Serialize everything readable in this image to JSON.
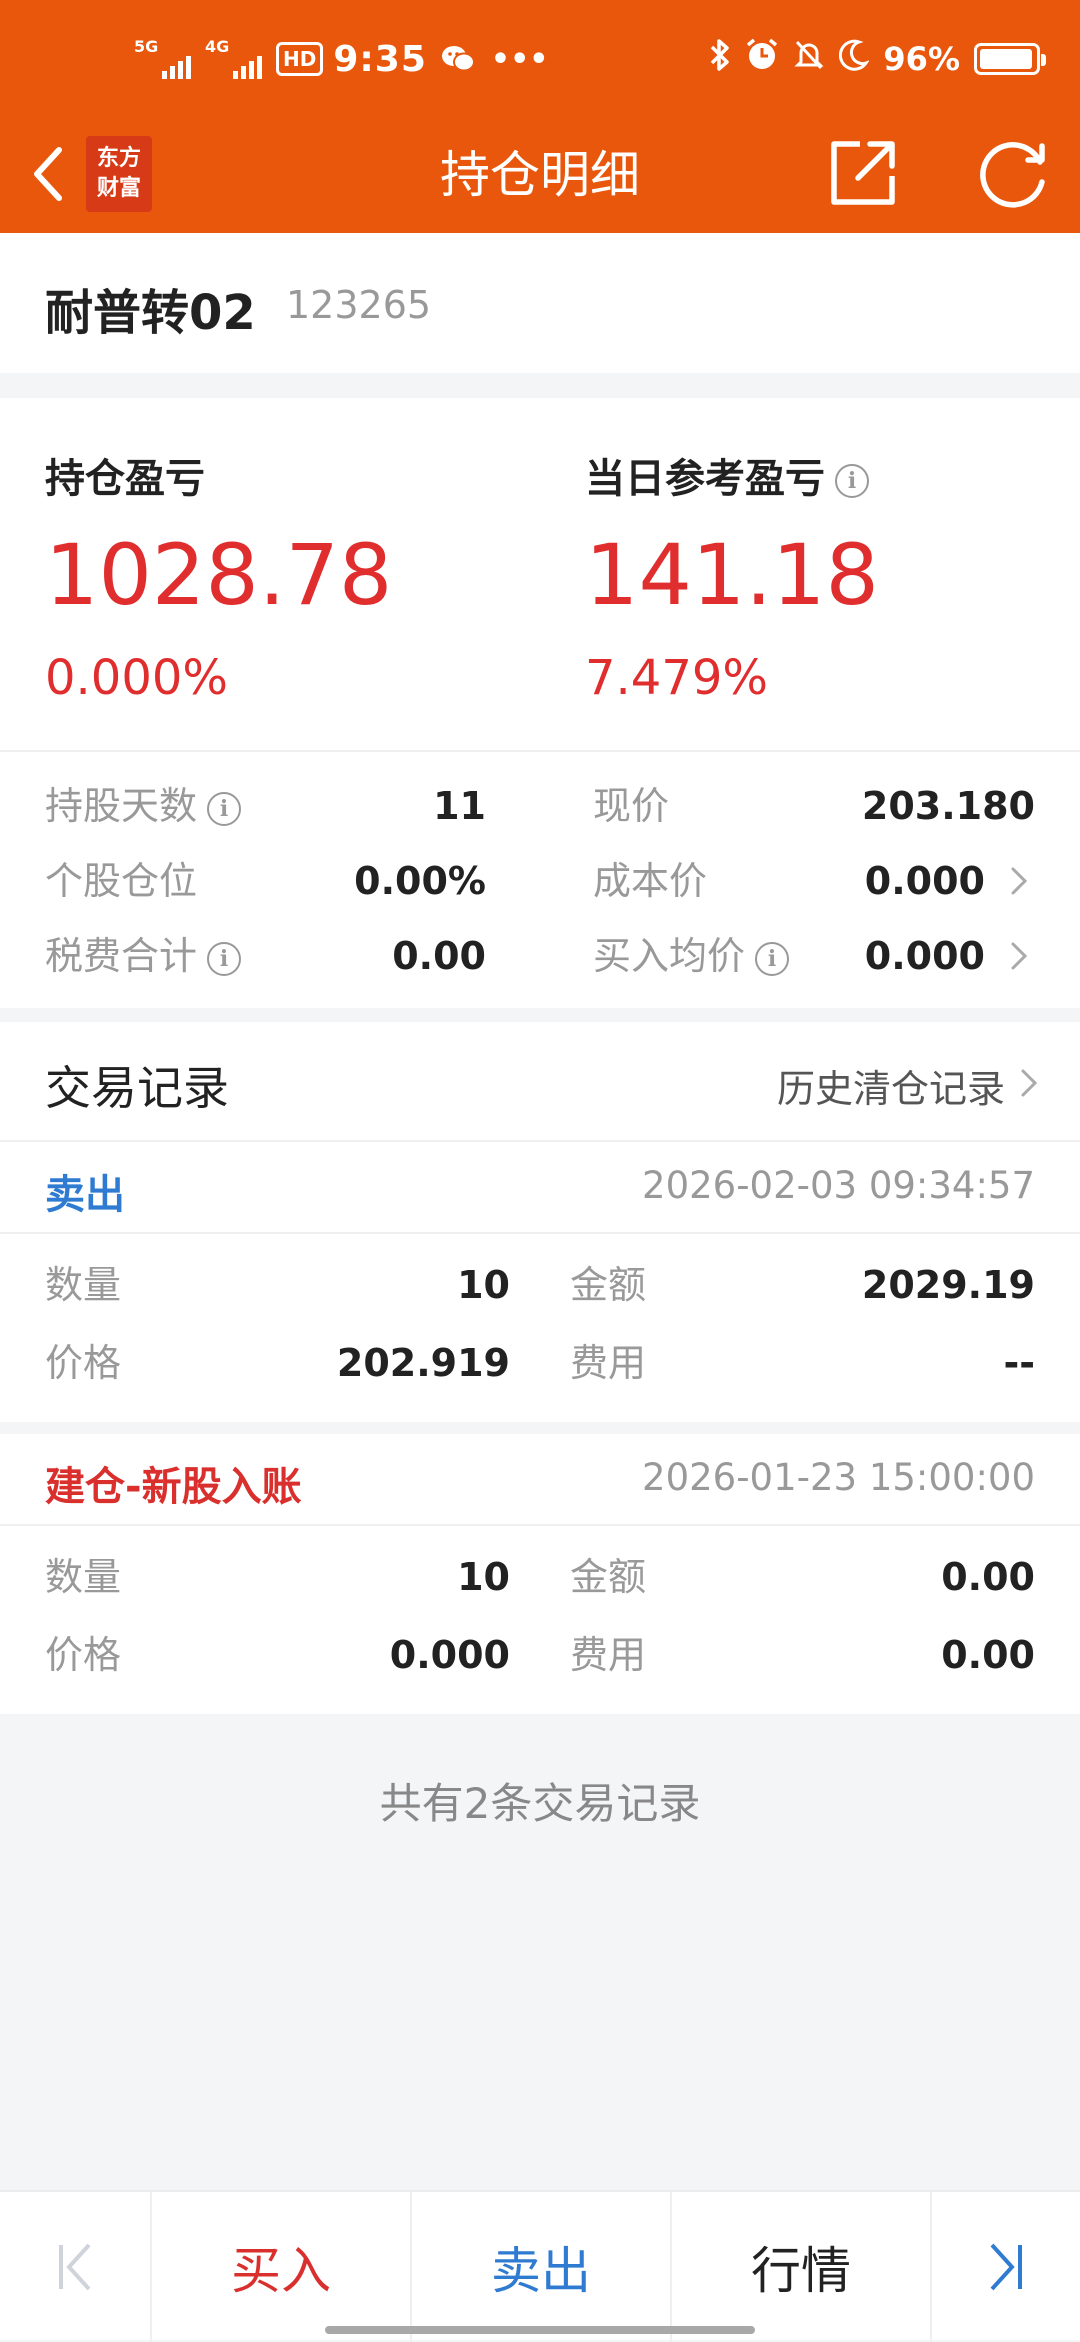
{
  "status_bar": {
    "net1": "5G",
    "net2": "4G",
    "hd": "HD",
    "time": "9:35",
    "battery": "96%",
    "battery_level": 0.96
  },
  "nav": {
    "logo_line1": "东方",
    "logo_line2": "财富",
    "title": "持仓明细"
  },
  "stock": {
    "name": "耐普转02",
    "code": "123265"
  },
  "summary": {
    "holding_pl_label": "持仓盈亏",
    "holding_pl_value": "1028.78",
    "holding_pl_pct": "0.000%",
    "daily_pl_label": "当日参考盈亏",
    "daily_pl_value": "141.18",
    "daily_pl_pct": "7.479%"
  },
  "details": {
    "days_label": "持股天数",
    "days_value": "11",
    "price_label": "现价",
    "price_value": "203.180",
    "position_label": "个股仓位",
    "position_value": "0.00%",
    "cost_label": "成本价",
    "cost_value": "0.000",
    "fees_label": "税费合计",
    "fees_value": "0.00",
    "avg_buy_label": "买入均价",
    "avg_buy_value": "0.000"
  },
  "records": {
    "title": "交易记录",
    "history_link": "历史清仓记录",
    "items": [
      {
        "type": "卖出",
        "type_color": "#2f7bd1",
        "time": "2026-02-03 09:34:57",
        "qty_label": "数量",
        "qty": "10",
        "amount_label": "金额",
        "amount": "2029.19",
        "price_label": "价格",
        "price": "202.919",
        "fee_label": "费用",
        "fee": "--"
      },
      {
        "type": "建仓-新股入账",
        "type_color": "#d9302e",
        "time": "2026-01-23 15:00:00",
        "qty_label": "数量",
        "qty": "10",
        "amount_label": "金额",
        "amount": "0.00",
        "price_label": "价格",
        "price": "0.000",
        "fee_label": "费用",
        "fee": "0.00"
      }
    ],
    "footer": "共有2条交易记录"
  },
  "bottom_bar": {
    "buy": "买入",
    "sell": "卖出",
    "quote": "行情"
  },
  "colors": {
    "brand_orange": "#e8570c",
    "up_red": "#e02d2d",
    "sell_blue": "#2f7bd1"
  }
}
